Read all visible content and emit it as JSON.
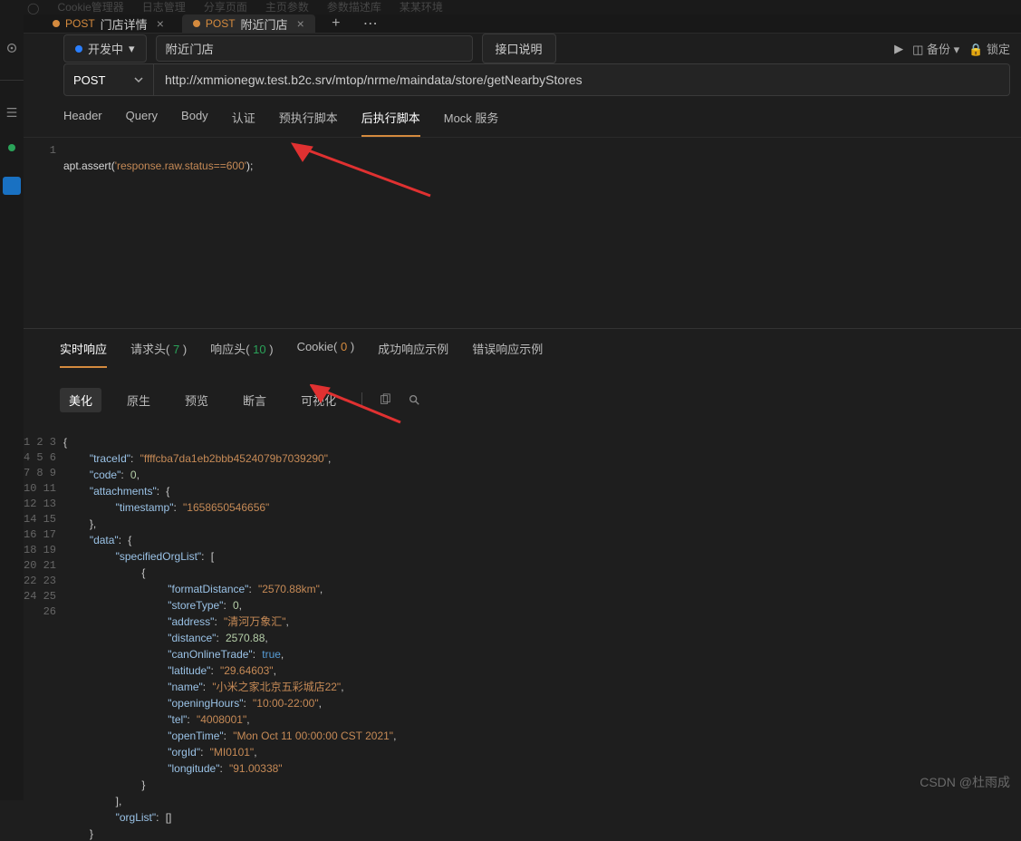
{
  "menubar": [
    "Cookie管理器",
    "日志管理",
    "分享页面",
    "主页参数",
    "参数描述库",
    "某某环境"
  ],
  "tabs": [
    {
      "method": "POST",
      "title": "门店详情",
      "active": false
    },
    {
      "method": "POST",
      "title": "附近门店",
      "active": true
    }
  ],
  "status": {
    "label": "开发中",
    "dropdown": "▾"
  },
  "nameValue": "附近门店",
  "descBtn": "接口说明",
  "rightBar": {
    "run": "▶",
    "backup": "◫ 备份",
    "lock": "🔒 锁定",
    "drop": "▾"
  },
  "method": "POST",
  "url": "http://xmmionegw.test.b2c.srv/mtop/nrme/maindata/store/getNearbyStores",
  "reqTabs": [
    "Header",
    "Query",
    "Body",
    "认证",
    "预执行脚本",
    "后执行脚本",
    "Mock 服务"
  ],
  "reqActive": "后执行脚本",
  "scriptLine": {
    "pre": "apt.assert(",
    "str": "'response.raw.status==600'",
    "post": ");"
  },
  "respTabs": [
    {
      "label": "实时响应",
      "count": null,
      "active": true
    },
    {
      "label": "请求头",
      "count": "7",
      "cls": "g"
    },
    {
      "label": "响应头",
      "count": "10",
      "cls": "g"
    },
    {
      "label": "Cookie",
      "count": "0",
      "cls": "z"
    },
    {
      "label": "成功响应示例"
    },
    {
      "label": "错误响应示例"
    }
  ],
  "viewTabs": [
    "美化",
    "原生",
    "预览",
    "断言",
    "可视化"
  ],
  "viewActive": "美化",
  "json": {
    "traceId": "ffffcba7da1eb2bbb4524079b7039290",
    "code": 0,
    "attachments": {
      "timestamp": "1658650546656"
    },
    "data": {
      "specifiedOrgList": [
        {
          "formatDistance": "2570.88km",
          "storeType": 0,
          "address": "清河万象汇",
          "distance": 2570.88,
          "canOnlineTrade": true,
          "latitude": "29.64603",
          "name": "小米之家北京五彩城店22",
          "openingHours": "10:00-22:00",
          "tel": "4008001",
          "openTime": "Mon Oct 11 00:00:00 CST 2021",
          "orgId": "MI0101",
          "longitude": "91.00338"
        }
      ],
      "orgList": []
    }
  },
  "watermark": "CSDN @杜雨成"
}
